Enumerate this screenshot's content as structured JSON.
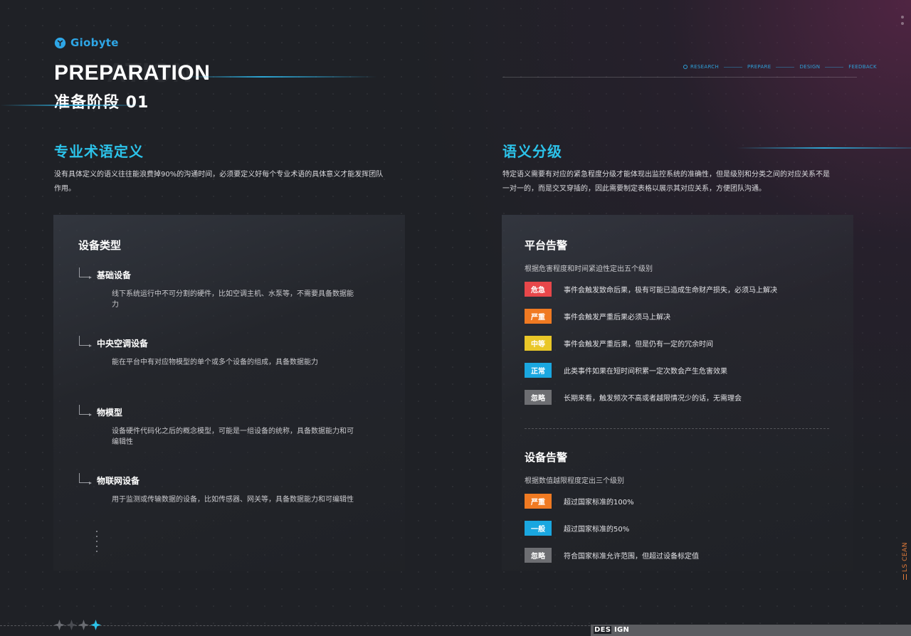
{
  "brand": {
    "name": "Giobyte"
  },
  "header": {
    "ghost_text": "ATION",
    "title": "PREPARATION",
    "subtitle": "准备阶段 01"
  },
  "steps": [
    {
      "label": "RESEARCH",
      "active": true
    },
    {
      "label": "PREPARE",
      "active": false
    },
    {
      "label": "DESIGN",
      "active": false
    },
    {
      "label": "FEEDBACK",
      "active": false
    }
  ],
  "left": {
    "title": "专业术语定义",
    "description_line1": "没有具体定义的语义往往能浪费掉90%的沟通时间，必须要定义好每个专业术语的具体意义才能发挥团队",
    "description_line2": "作用。",
    "card_title": "设备类型",
    "terms": [
      {
        "name": "基础设备",
        "desc": "线下系统运行中不可分割的硬件，比如空调主机、水泵等，不需要具备数据能力"
      },
      {
        "name": "中央空调设备",
        "desc": "能在平台中有对应物模型的单个或多个设备的组成，具备数据能力"
      },
      {
        "name": "物模型",
        "desc": "设备硬件代码化之后的概念模型，可能是一组设备的统称，具备数据能力和可编辑性"
      },
      {
        "name": "物联网设备",
        "desc": "用于监测或传输数据的设备，比如传感器、网关等，具备数据能力和可编辑性"
      }
    ]
  },
  "right": {
    "title": "语义分级",
    "description_line1": "特定语义需要有对应的紧急程度分级才能体现出监控系统的准确性，但是级别和分类之间的对应关系不是",
    "description_line2": "一对一的，而是交叉穿插的，因此需要制定表格以展示其对应关系，方便团队沟通。",
    "platform_alarm": {
      "title": "平台告警",
      "desc": "根据危害程度和时间紧迫性定出五个级别",
      "levels": [
        {
          "badge": "危急",
          "color": "#e8474a",
          "text": "事件会触发致命后果，极有可能已造成生命财产损失，必须马上解决"
        },
        {
          "badge": "严重",
          "color": "#f07a22",
          "text": "事件会触发严重后果必须马上解决"
        },
        {
          "badge": "中等",
          "color": "#e9c728",
          "text": "事件会触发严重后果，但是仍有一定的冗余时间"
        },
        {
          "badge": "正常",
          "color": "#1aa7e0",
          "text": "此类事件如果在短时间积累一定次数会产生危害效果"
        },
        {
          "badge": "忽略",
          "color": "#6d6e72",
          "text": "长期来看，触发频次不高或者越限情况少的话，无需理会"
        }
      ]
    },
    "device_alarm": {
      "title": "设备告警",
      "desc": "根据数值越限程度定出三个级别",
      "levels": [
        {
          "badge": "严重",
          "color": "#f07a22",
          "text": "超过国家标准的100%"
        },
        {
          "badge": "一般",
          "color": "#1aa7e0",
          "text": "超过国家标准的50%"
        },
        {
          "badge": "忽略",
          "color": "#6d6e72",
          "text": "符合国家标准允许范围，但超过设备标定值"
        }
      ]
    }
  },
  "footer": {
    "label_a": "DES",
    "label_b": "IGN",
    "side_tag": "LS CEAN"
  },
  "colors": {
    "accent": "#2cc3ea",
    "brand": "#2ea6e6",
    "side_tag": "#e07a3a"
  }
}
